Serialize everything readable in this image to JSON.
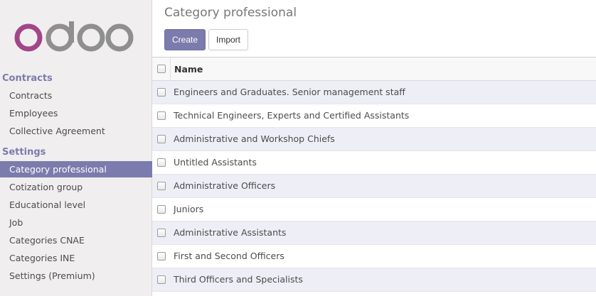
{
  "brand": {
    "logo_text": "odoo",
    "accent_color": "#7c7bad",
    "logo_o_color": "#a24689",
    "logo_gray_color": "#8f8f8f"
  },
  "sidebar": {
    "sections": [
      {
        "title": "Contracts",
        "items": [
          {
            "label": "Contracts",
            "active": false
          },
          {
            "label": "Employees",
            "active": false
          },
          {
            "label": "Collective Agreement",
            "active": false
          }
        ]
      },
      {
        "title": "Settings",
        "items": [
          {
            "label": "Category professional",
            "active": true
          },
          {
            "label": "Cotization group",
            "active": false
          },
          {
            "label": "Educational level",
            "active": false
          },
          {
            "label": "Job",
            "active": false
          },
          {
            "label": "Categories CNAE",
            "active": false
          },
          {
            "label": "Categories INE",
            "active": false
          },
          {
            "label": "Settings (Premium)",
            "active": false
          }
        ]
      }
    ]
  },
  "header": {
    "title": "Category professional",
    "create_label": "Create",
    "import_label": "Import"
  },
  "table": {
    "columns": [
      "Name"
    ],
    "rows": [
      "Engineers and Graduates. Senior management staff",
      "Technical Engineers, Experts and Certified Assistants",
      "Administrative and Workshop Chiefs",
      "Untitled Assistants",
      "Administrative Officers",
      "Juniors",
      "Administrative Assistants",
      "First and Second Officers",
      "Third Officers and Specialists"
    ]
  }
}
